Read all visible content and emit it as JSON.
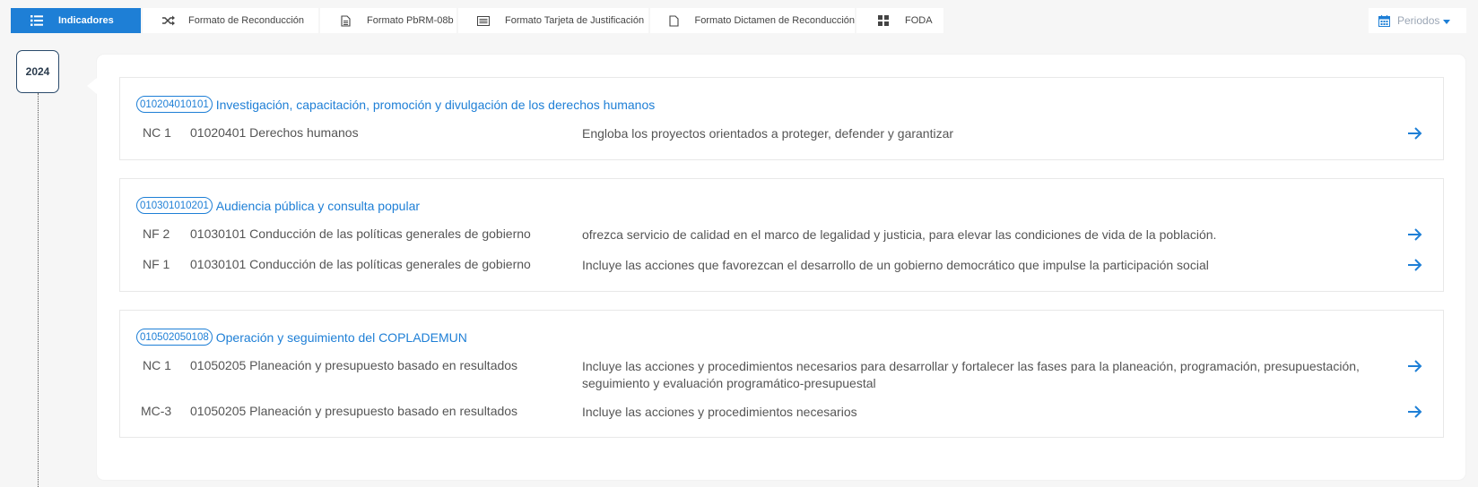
{
  "tabs": [
    {
      "label": "Indicadores",
      "icon": "list-icon",
      "active": true
    },
    {
      "label": "Formato de Reconducción",
      "icon": "shuffle-icon",
      "active": false
    },
    {
      "label": "Formato PbRM-08b",
      "icon": "file-text-icon",
      "active": false
    },
    {
      "label": "Formato Tarjeta de Justificación",
      "icon": "card-list-icon",
      "active": false
    },
    {
      "label": "Formato Dictamen de Reconducción",
      "icon": "file-icon",
      "active": false
    },
    {
      "label": "FODA",
      "icon": "grid-icon",
      "active": false
    }
  ],
  "periods": {
    "label": "Periodos",
    "icon": "calendar-icon"
  },
  "timeline": {
    "year": "2024"
  },
  "accent_color": "#1e7fd6",
  "projects": [
    {
      "code": "010204010101",
      "title": "Investigación, capacitación, promoción y divulgación de los derechos humanos",
      "rows": [
        {
          "level": "NC 1",
          "program": "01020401 Derechos humanos",
          "description": "Engloba los proyectos orientados a proteger, defender y garantizar"
        }
      ]
    },
    {
      "code": "010301010201",
      "title": "Audiencia pública y consulta popular",
      "rows": [
        {
          "level": "NF 2",
          "program": "01030101 Conducción de las políticas generales de gobierno",
          "description": "ofrezca servicio de calidad en el marco de legalidad y justicia, para elevar las condiciones de vida de la población."
        },
        {
          "level": "NF 1",
          "program": "01030101 Conducción de las políticas generales de gobierno",
          "description": "Incluye las acciones que favorezcan el desarrollo de un gobierno democrático que impulse la participación social"
        }
      ]
    },
    {
      "code": "010502050108",
      "title": "Operación y seguimiento del COPLADEMUN",
      "rows": [
        {
          "level": "NC 1",
          "program": "01050205 Planeación y presupuesto basado en resultados",
          "description": "Incluye las acciones y procedimientos necesarios para desarrollar y fortalecer las fases para la planeación, programación, presupuestación, seguimiento y evaluación programático-presupuestal"
        },
        {
          "level": "MC-3",
          "program": "01050205 Planeación y presupuesto basado en resultados",
          "description": "Incluye las acciones y procedimientos necesarios"
        }
      ]
    }
  ]
}
